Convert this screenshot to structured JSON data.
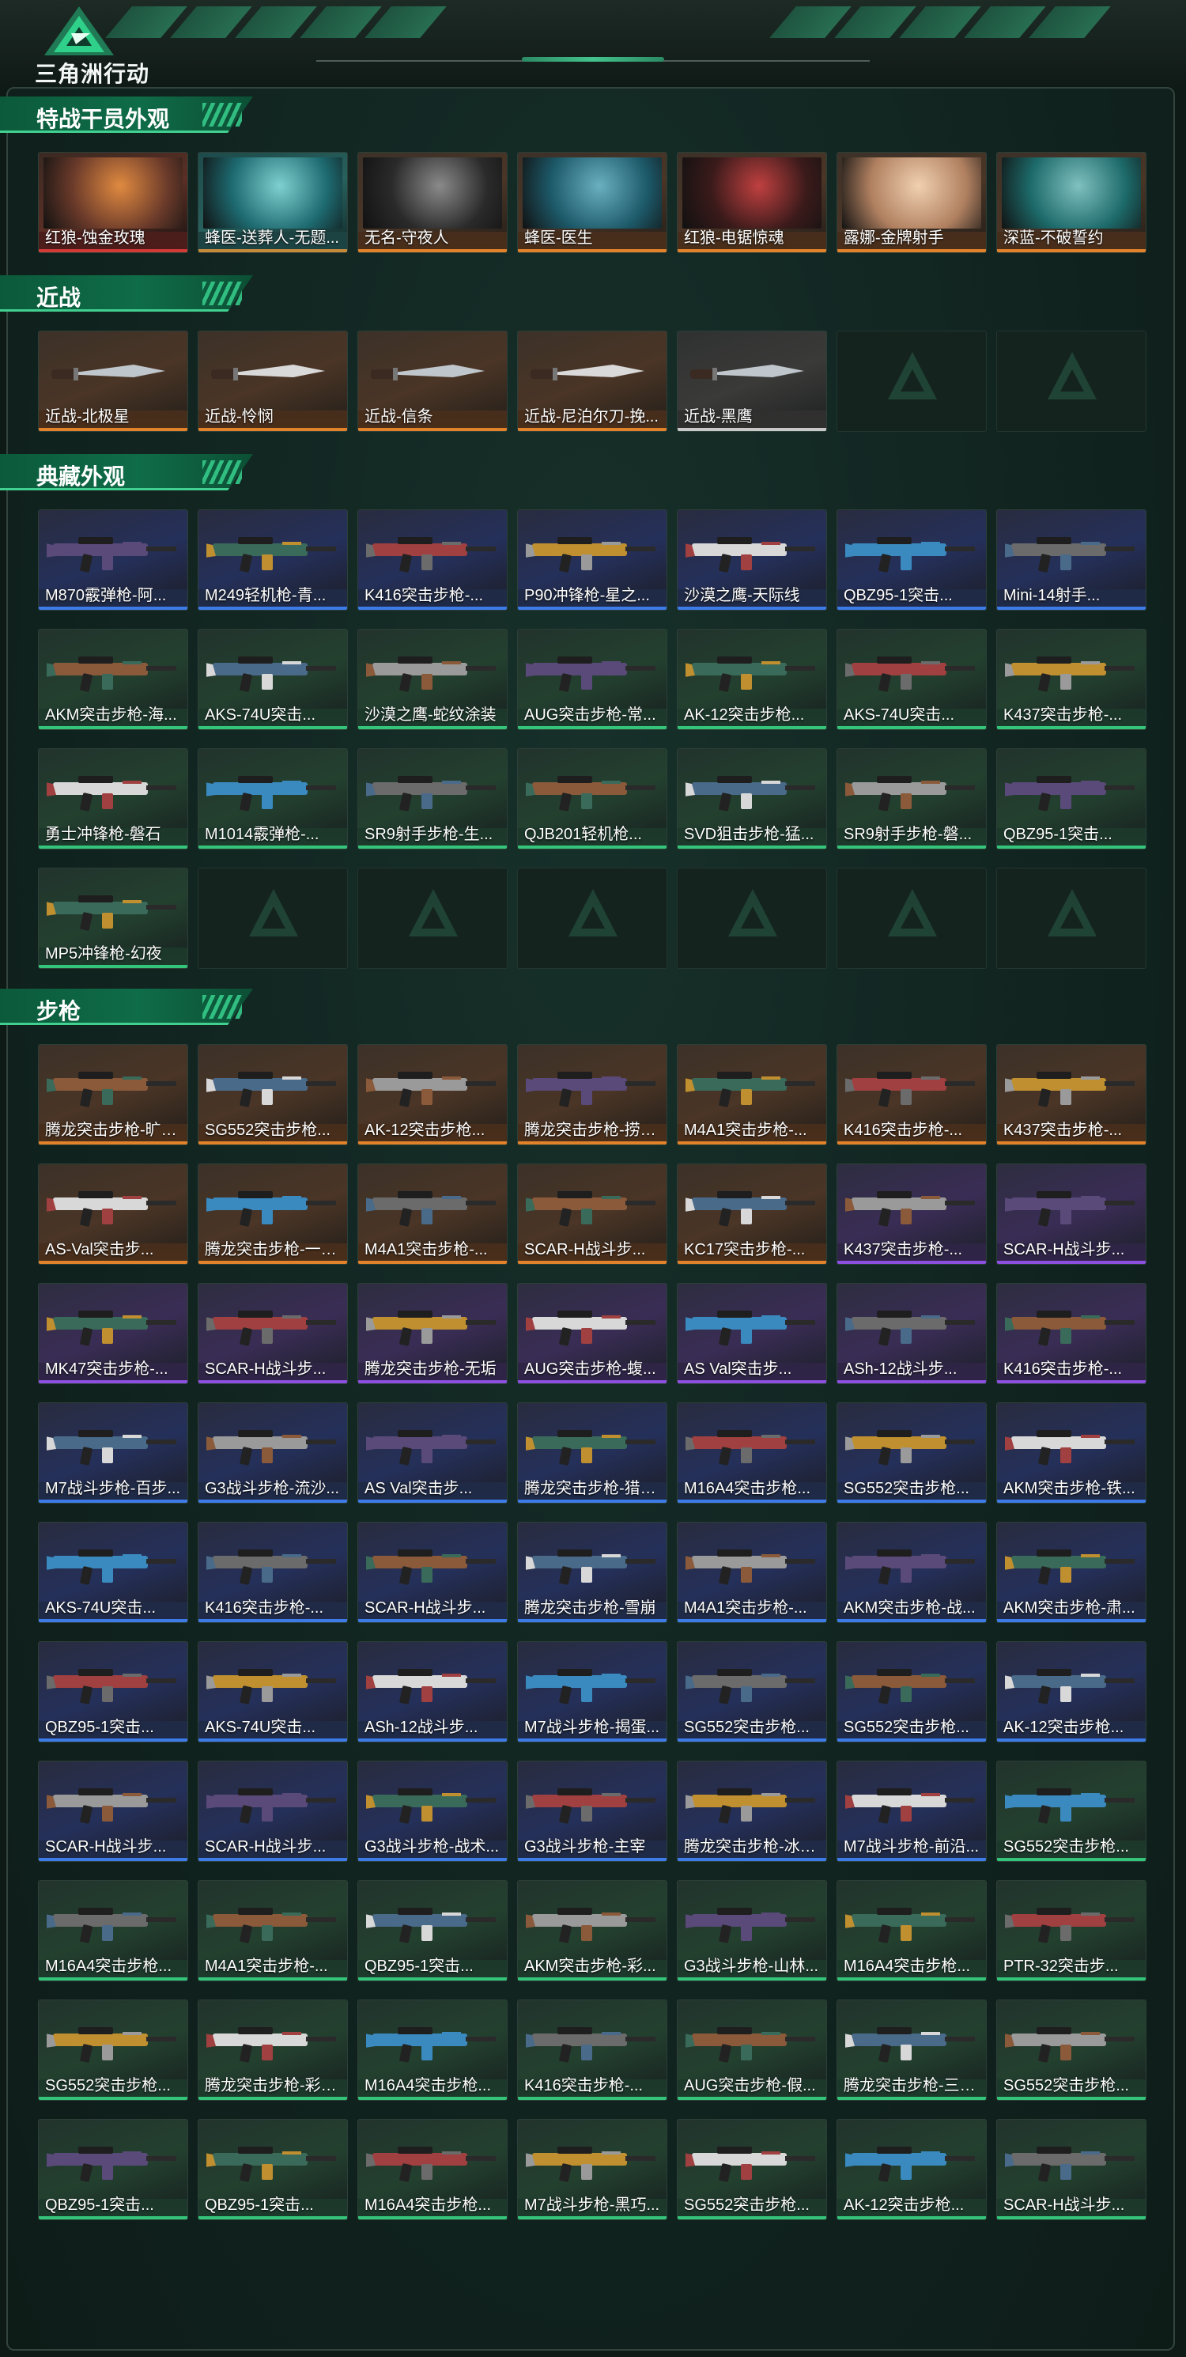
{
  "header": {
    "brand": "三角洲行动",
    "logo_icon": "delta-triangle-logo-icon"
  },
  "sections": [
    {
      "id": "operators",
      "title": "特战干员外观",
      "items": [
        {
          "name": "红狼-蚀金玫瑰",
          "rarity": "red"
        },
        {
          "name": "蜂医-送葬人-无题...",
          "rarity": "teal"
        },
        {
          "name": "无名-守夜人",
          "rarity": "orange"
        },
        {
          "name": "蜂医-医生",
          "rarity": "orange"
        },
        {
          "name": "红狼-电锯惊魂",
          "rarity": "orange"
        },
        {
          "name": "露娜-金牌射手",
          "rarity": "orange"
        },
        {
          "name": "深蓝-不破誓约",
          "rarity": "orange"
        }
      ]
    },
    {
      "id": "melee",
      "title": "近战",
      "items": [
        {
          "name": "近战-北极星",
          "rarity": "orange"
        },
        {
          "name": "近战-怜悯",
          "rarity": "orange"
        },
        {
          "name": "近战-信条",
          "rarity": "orange"
        },
        {
          "name": "近战-尼泊尔刀-挽...",
          "rarity": "orange"
        },
        {
          "name": "近战-黑鹰",
          "rarity": "white"
        },
        {
          "name": "",
          "rarity": "empty"
        },
        {
          "name": "",
          "rarity": "empty"
        }
      ]
    },
    {
      "id": "collection",
      "title": "典藏外观",
      "items": [
        {
          "name": "M870霰弹枪-阿...",
          "rarity": "blue"
        },
        {
          "name": "M249轻机枪-青...",
          "rarity": "blue"
        },
        {
          "name": "K416突击步枪-...",
          "rarity": "blue"
        },
        {
          "name": "P90冲锋枪-星之...",
          "rarity": "blue"
        },
        {
          "name": "沙漠之鹰-天际线",
          "rarity": "blue"
        },
        {
          "name": "QBZ95-1突击...",
          "rarity": "blue"
        },
        {
          "name": "Mini-14射手...",
          "rarity": "blue"
        },
        {
          "name": "AKM突击步枪-海...",
          "rarity": "green"
        },
        {
          "name": "AKS-74U突击...",
          "rarity": "green"
        },
        {
          "name": "沙漠之鹰-蛇纹涂装",
          "rarity": "green"
        },
        {
          "name": "AUG突击步枪-常...",
          "rarity": "green"
        },
        {
          "name": "AK-12突击步枪...",
          "rarity": "green"
        },
        {
          "name": "AKS-74U突击...",
          "rarity": "green"
        },
        {
          "name": "K437突击步枪-...",
          "rarity": "green"
        },
        {
          "name": "勇士冲锋枪-磐石",
          "rarity": "green"
        },
        {
          "name": "M1014霰弹枪-...",
          "rarity": "green"
        },
        {
          "name": "SR9射手步枪-生...",
          "rarity": "green"
        },
        {
          "name": "QJB201轻机枪...",
          "rarity": "green"
        },
        {
          "name": "SVD狙击步枪-猛...",
          "rarity": "green"
        },
        {
          "name": "SR9射手步枪-磐...",
          "rarity": "green"
        },
        {
          "name": "QBZ95-1突击...",
          "rarity": "green"
        },
        {
          "name": "MP5冲锋枪-幻夜",
          "rarity": "green"
        },
        {
          "name": "",
          "rarity": "empty"
        },
        {
          "name": "",
          "rarity": "empty"
        },
        {
          "name": "",
          "rarity": "empty"
        },
        {
          "name": "",
          "rarity": "empty"
        },
        {
          "name": "",
          "rarity": "empty"
        },
        {
          "name": "",
          "rarity": "empty"
        }
      ]
    },
    {
      "id": "rifles",
      "title": "步枪",
      "items": [
        {
          "name": "腾龙突击步枪-旷野...",
          "rarity": "orange"
        },
        {
          "name": "SG552突击步枪...",
          "rarity": "orange"
        },
        {
          "name": "AK-12突击步枪...",
          "rarity": "orange"
        },
        {
          "name": "腾龙突击步枪-捞点...",
          "rarity": "orange"
        },
        {
          "name": "M4A1突击步枪-...",
          "rarity": "orange"
        },
        {
          "name": "K416突击步枪-...",
          "rarity": "orange"
        },
        {
          "name": "K437突击步枪-...",
          "rarity": "orange"
        },
        {
          "name": "AS-Val突击步...",
          "rarity": "orange"
        },
        {
          "name": "腾龙突击步枪-一拾...",
          "rarity": "orange"
        },
        {
          "name": "M4A1突击步枪-...",
          "rarity": "orange"
        },
        {
          "name": "SCAR-H战斗步...",
          "rarity": "orange"
        },
        {
          "name": "KC17突击步枪-...",
          "rarity": "orange"
        },
        {
          "name": "K437突击步枪-...",
          "rarity": "purple"
        },
        {
          "name": "SCAR-H战斗步...",
          "rarity": "purple"
        },
        {
          "name": "MK47突击步枪-...",
          "rarity": "purple"
        },
        {
          "name": "SCAR-H战斗步...",
          "rarity": "purple"
        },
        {
          "name": "腾龙突击步枪-无垢",
          "rarity": "purple"
        },
        {
          "name": "AUG突击步枪-蝮...",
          "rarity": "purple"
        },
        {
          "name": "AS Val突击步...",
          "rarity": "purple"
        },
        {
          "name": "ASh-12战斗步...",
          "rarity": "purple"
        },
        {
          "name": "K416突击步枪-...",
          "rarity": "purple"
        },
        {
          "name": "M7战斗步枪-百步...",
          "rarity": "blue"
        },
        {
          "name": "G3战斗步枪-流沙...",
          "rarity": "blue"
        },
        {
          "name": "AS Val突击步...",
          "rarity": "blue"
        },
        {
          "name": "腾龙突击步枪-猎鳄...",
          "rarity": "blue"
        },
        {
          "name": "M16A4突击步枪...",
          "rarity": "blue"
        },
        {
          "name": "SG552突击步枪...",
          "rarity": "blue"
        },
        {
          "name": "AKM突击步枪-铁...",
          "rarity": "blue"
        },
        {
          "name": "AKS-74U突击...",
          "rarity": "blue"
        },
        {
          "name": "K416突击步枪-...",
          "rarity": "blue"
        },
        {
          "name": "SCAR-H战斗步...",
          "rarity": "blue"
        },
        {
          "name": "腾龙突击步枪-雪崩",
          "rarity": "blue"
        },
        {
          "name": "M4A1突击步枪-...",
          "rarity": "blue"
        },
        {
          "name": "AKM突击步枪-战...",
          "rarity": "blue"
        },
        {
          "name": "AKM突击步枪-肃...",
          "rarity": "blue"
        },
        {
          "name": "QBZ95-1突击...",
          "rarity": "blue"
        },
        {
          "name": "AKS-74U突击...",
          "rarity": "blue"
        },
        {
          "name": "ASh-12战斗步...",
          "rarity": "blue"
        },
        {
          "name": "M7战斗步枪-揭蛋...",
          "rarity": "blue"
        },
        {
          "name": "SG552突击步枪...",
          "rarity": "blue"
        },
        {
          "name": "SG552突击步枪...",
          "rarity": "blue"
        },
        {
          "name": "AK-12突击步枪...",
          "rarity": "blue"
        },
        {
          "name": "SCAR-H战斗步...",
          "rarity": "blue"
        },
        {
          "name": "SCAR-H战斗步...",
          "rarity": "blue"
        },
        {
          "name": "G3战斗步枪-战术...",
          "rarity": "blue"
        },
        {
          "name": "G3战斗步枪-主宰",
          "rarity": "blue"
        },
        {
          "name": "腾龙突击步枪-冰天...",
          "rarity": "blue"
        },
        {
          "name": "M7战斗步枪-前沿...",
          "rarity": "blue"
        },
        {
          "name": "SG552突击步枪...",
          "rarity": "green"
        },
        {
          "name": "M16A4突击步枪...",
          "rarity": "green"
        },
        {
          "name": "M4A1突击步枪-...",
          "rarity": "green"
        },
        {
          "name": "QBZ95-1突击...",
          "rarity": "green"
        },
        {
          "name": "AKM突击步枪-彩...",
          "rarity": "green"
        },
        {
          "name": "G3战斗步枪-山林...",
          "rarity": "green"
        },
        {
          "name": "M16A4突击步枪...",
          "rarity": "green"
        },
        {
          "name": "PTR-32突击步...",
          "rarity": "green"
        },
        {
          "name": "SG552突击步枪...",
          "rarity": "green"
        },
        {
          "name": "腾龙突击步枪-彩墨...",
          "rarity": "green"
        },
        {
          "name": "M16A4突击步枪...",
          "rarity": "green"
        },
        {
          "name": "K416突击步枪-...",
          "rarity": "green"
        },
        {
          "name": "AUG突击步枪-假...",
          "rarity": "green"
        },
        {
          "name": "腾龙突击步枪-三角...",
          "rarity": "green"
        },
        {
          "name": "SG552突击步枪...",
          "rarity": "green"
        },
        {
          "name": "QBZ95-1突击...",
          "rarity": "green"
        },
        {
          "name": "QBZ95-1突击...",
          "rarity": "green"
        },
        {
          "name": "M16A4突击步枪...",
          "rarity": "green"
        },
        {
          "name": "M7战斗步枪-黑巧...",
          "rarity": "green"
        },
        {
          "name": "SG552突击步枪...",
          "rarity": "green"
        },
        {
          "name": "AK-12突击步枪...",
          "rarity": "green"
        },
        {
          "name": "SCAR-H战斗步...",
          "rarity": "green"
        }
      ]
    }
  ],
  "colors": {
    "accent_green": "#41d08f",
    "rarity_red": "#d23a37",
    "rarity_orange": "#e2822a",
    "rarity_purple": "#8c4fe0",
    "rarity_blue": "#3d7be8",
    "rarity_green": "#34c47a",
    "rarity_white": "#c9c9c9"
  }
}
